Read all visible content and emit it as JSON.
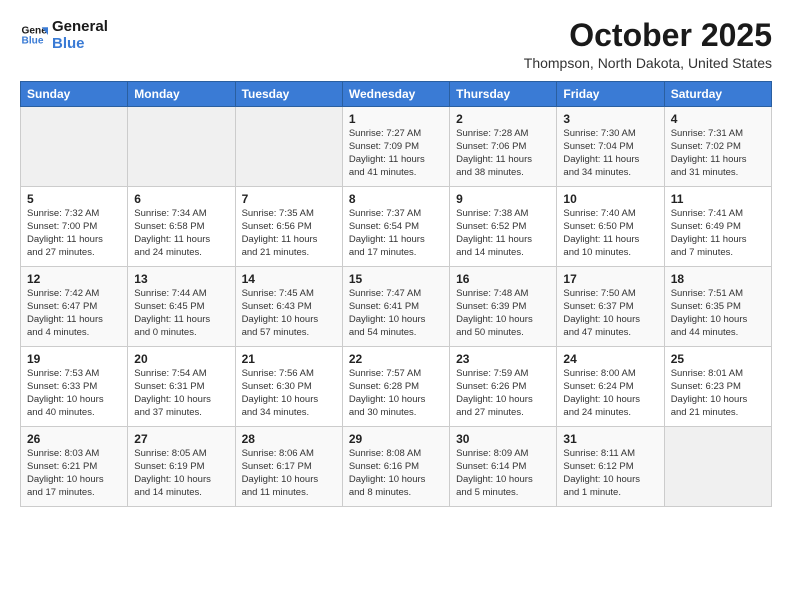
{
  "header": {
    "logo_line1": "General",
    "logo_line2": "Blue",
    "month_title": "October 2025",
    "location": "Thompson, North Dakota, United States"
  },
  "weekdays": [
    "Sunday",
    "Monday",
    "Tuesday",
    "Wednesday",
    "Thursday",
    "Friday",
    "Saturday"
  ],
  "weeks": [
    [
      {
        "day": "",
        "empty": true
      },
      {
        "day": "",
        "empty": true
      },
      {
        "day": "",
        "empty": true
      },
      {
        "day": "1",
        "sunrise": "7:27 AM",
        "sunset": "7:09 PM",
        "daylight": "11 hours and 41 minutes."
      },
      {
        "day": "2",
        "sunrise": "7:28 AM",
        "sunset": "7:06 PM",
        "daylight": "11 hours and 38 minutes."
      },
      {
        "day": "3",
        "sunrise": "7:30 AM",
        "sunset": "7:04 PM",
        "daylight": "11 hours and 34 minutes."
      },
      {
        "day": "4",
        "sunrise": "7:31 AM",
        "sunset": "7:02 PM",
        "daylight": "11 hours and 31 minutes."
      }
    ],
    [
      {
        "day": "5",
        "sunrise": "7:32 AM",
        "sunset": "7:00 PM",
        "daylight": "11 hours and 27 minutes."
      },
      {
        "day": "6",
        "sunrise": "7:34 AM",
        "sunset": "6:58 PM",
        "daylight": "11 hours and 24 minutes."
      },
      {
        "day": "7",
        "sunrise": "7:35 AM",
        "sunset": "6:56 PM",
        "daylight": "11 hours and 21 minutes."
      },
      {
        "day": "8",
        "sunrise": "7:37 AM",
        "sunset": "6:54 PM",
        "daylight": "11 hours and 17 minutes."
      },
      {
        "day": "9",
        "sunrise": "7:38 AM",
        "sunset": "6:52 PM",
        "daylight": "11 hours and 14 minutes."
      },
      {
        "day": "10",
        "sunrise": "7:40 AM",
        "sunset": "6:50 PM",
        "daylight": "11 hours and 10 minutes."
      },
      {
        "day": "11",
        "sunrise": "7:41 AM",
        "sunset": "6:49 PM",
        "daylight": "11 hours and 7 minutes."
      }
    ],
    [
      {
        "day": "12",
        "sunrise": "7:42 AM",
        "sunset": "6:47 PM",
        "daylight": "11 hours and 4 minutes."
      },
      {
        "day": "13",
        "sunrise": "7:44 AM",
        "sunset": "6:45 PM",
        "daylight": "11 hours and 0 minutes."
      },
      {
        "day": "14",
        "sunrise": "7:45 AM",
        "sunset": "6:43 PM",
        "daylight": "10 hours and 57 minutes."
      },
      {
        "day": "15",
        "sunrise": "7:47 AM",
        "sunset": "6:41 PM",
        "daylight": "10 hours and 54 minutes."
      },
      {
        "day": "16",
        "sunrise": "7:48 AM",
        "sunset": "6:39 PM",
        "daylight": "10 hours and 50 minutes."
      },
      {
        "day": "17",
        "sunrise": "7:50 AM",
        "sunset": "6:37 PM",
        "daylight": "10 hours and 47 minutes."
      },
      {
        "day": "18",
        "sunrise": "7:51 AM",
        "sunset": "6:35 PM",
        "daylight": "10 hours and 44 minutes."
      }
    ],
    [
      {
        "day": "19",
        "sunrise": "7:53 AM",
        "sunset": "6:33 PM",
        "daylight": "10 hours and 40 minutes."
      },
      {
        "day": "20",
        "sunrise": "7:54 AM",
        "sunset": "6:31 PM",
        "daylight": "10 hours and 37 minutes."
      },
      {
        "day": "21",
        "sunrise": "7:56 AM",
        "sunset": "6:30 PM",
        "daylight": "10 hours and 34 minutes."
      },
      {
        "day": "22",
        "sunrise": "7:57 AM",
        "sunset": "6:28 PM",
        "daylight": "10 hours and 30 minutes."
      },
      {
        "day": "23",
        "sunrise": "7:59 AM",
        "sunset": "6:26 PM",
        "daylight": "10 hours and 27 minutes."
      },
      {
        "day": "24",
        "sunrise": "8:00 AM",
        "sunset": "6:24 PM",
        "daylight": "10 hours and 24 minutes."
      },
      {
        "day": "25",
        "sunrise": "8:01 AM",
        "sunset": "6:23 PM",
        "daylight": "10 hours and 21 minutes."
      }
    ],
    [
      {
        "day": "26",
        "sunrise": "8:03 AM",
        "sunset": "6:21 PM",
        "daylight": "10 hours and 17 minutes."
      },
      {
        "day": "27",
        "sunrise": "8:05 AM",
        "sunset": "6:19 PM",
        "daylight": "10 hours and 14 minutes."
      },
      {
        "day": "28",
        "sunrise": "8:06 AM",
        "sunset": "6:17 PM",
        "daylight": "10 hours and 11 minutes."
      },
      {
        "day": "29",
        "sunrise": "8:08 AM",
        "sunset": "6:16 PM",
        "daylight": "10 hours and 8 minutes."
      },
      {
        "day": "30",
        "sunrise": "8:09 AM",
        "sunset": "6:14 PM",
        "daylight": "10 hours and 5 minutes."
      },
      {
        "day": "31",
        "sunrise": "8:11 AM",
        "sunset": "6:12 PM",
        "daylight": "10 hours and 1 minute."
      },
      {
        "day": "",
        "empty": true
      }
    ]
  ]
}
